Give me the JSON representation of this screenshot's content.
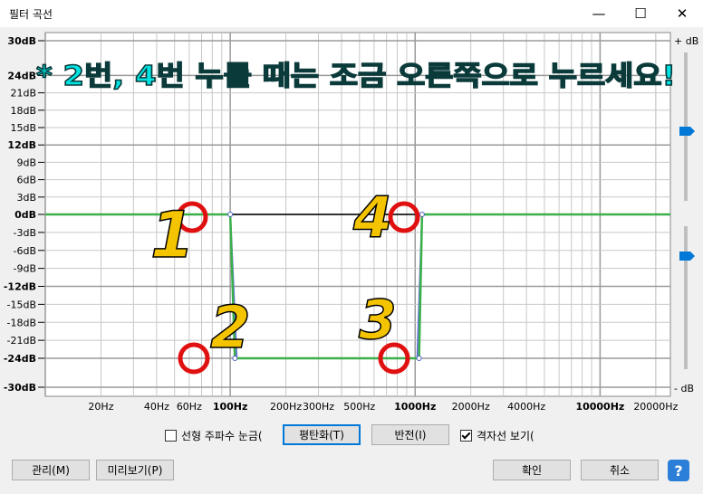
{
  "window": {
    "title": "필터 곡선",
    "minimize_glyph": "—",
    "maximize_glyph": "☐",
    "close_glyph": "✕"
  },
  "graph": {
    "db_labels": [
      "30dB",
      "24dB",
      "21dB",
      "18dB",
      "15dB",
      "12dB",
      "9dB",
      "6dB",
      "3dB",
      "0dB",
      "-3dB",
      "-6dB",
      "-9dB",
      "-12dB",
      "-15dB",
      "-18dB",
      "-21dB",
      "-24dB",
      "-30dB"
    ],
    "db_values": [
      30,
      24,
      21,
      18,
      15,
      12,
      9,
      6,
      3,
      0,
      -3,
      -6,
      -9,
      -12,
      -15,
      -18,
      -21,
      -24,
      -30
    ],
    "bold_db": [
      "30dB",
      "24dB",
      "12dB",
      "0dB",
      "-12dB",
      "-24dB",
      "-30dB"
    ],
    "freq_labels": [
      {
        "f": 20,
        "t": "20Hz"
      },
      {
        "f": 40,
        "t": "40Hz"
      },
      {
        "f": 60,
        "t": "60Hz"
      },
      {
        "f": 100,
        "t": "100Hz",
        "bold": true
      },
      {
        "f": 200,
        "t": "200Hz"
      },
      {
        "f": 300,
        "t": "300Hz"
      },
      {
        "f": 500,
        "t": "500Hz"
      },
      {
        "f": 1000,
        "t": "1000Hz",
        "bold": true
      },
      {
        "f": 2000,
        "t": "2000Hz"
      },
      {
        "f": 4000,
        "t": "4000Hz"
      },
      {
        "f": 10000,
        "t": "10000Hz",
        "bold": true
      },
      {
        "f": 20000,
        "t": "20000Hz"
      }
    ],
    "slider_top_label": "+ dB",
    "slider_bottom_label": "- dB",
    "curve_points_hz_db": [
      [
        10,
        0
      ],
      [
        100,
        0
      ],
      [
        106,
        -24
      ],
      [
        1050,
        -24
      ],
      [
        1090,
        0
      ],
      [
        24000,
        0
      ]
    ],
    "annotation": "* 2번, 4번 누를 때는 조금 오른쪽으로 누르세요!",
    "markers": [
      "1",
      "2",
      "3",
      "4"
    ],
    "colors": {
      "curve_green": "#3ab04a",
      "curve_blue": "#6a70e0",
      "circle_red": "#e01010",
      "number_yellow": "#f5c400",
      "annotation_cyan": "#00e3e3"
    }
  },
  "controls": {
    "linear_scale_label": "선형 주파수 눈금(",
    "linear_scale_checked": false,
    "flatten_label": "평탄화(T)",
    "invert_label": "반전(I)",
    "show_grid_label": "격자선 보기(",
    "show_grid_checked": true,
    "manage_label": "관리(M)",
    "preview_label": "미리보기(P)",
    "ok_label": "확인",
    "cancel_label": "취소",
    "help_glyph": "?"
  }
}
